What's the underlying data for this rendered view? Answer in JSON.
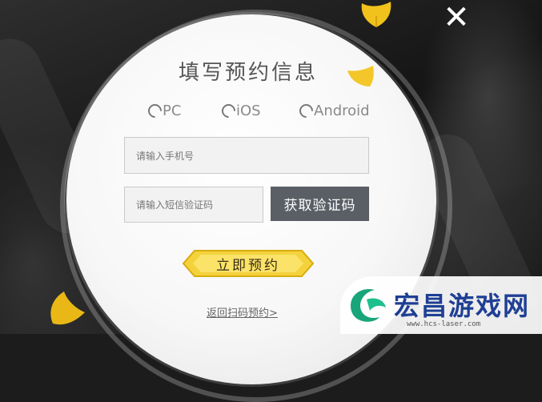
{
  "dialog": {
    "title": "填写预约信息",
    "platforms": [
      "PC",
      "iOS",
      "Android"
    ],
    "phone_placeholder": "请输入手机号",
    "code_placeholder": "请输入短信验证码",
    "get_code_label": "获取验证码",
    "reserve_label": "立即预约",
    "back_link": "返回扫码预约>"
  },
  "watermark": {
    "name": "宏昌游戏网",
    "url": "www.hcs-laser.com"
  },
  "colors": {
    "button_dark": "#5a5f66",
    "gold": "#f4d23c",
    "watermark_blue": "#1e3f94"
  }
}
